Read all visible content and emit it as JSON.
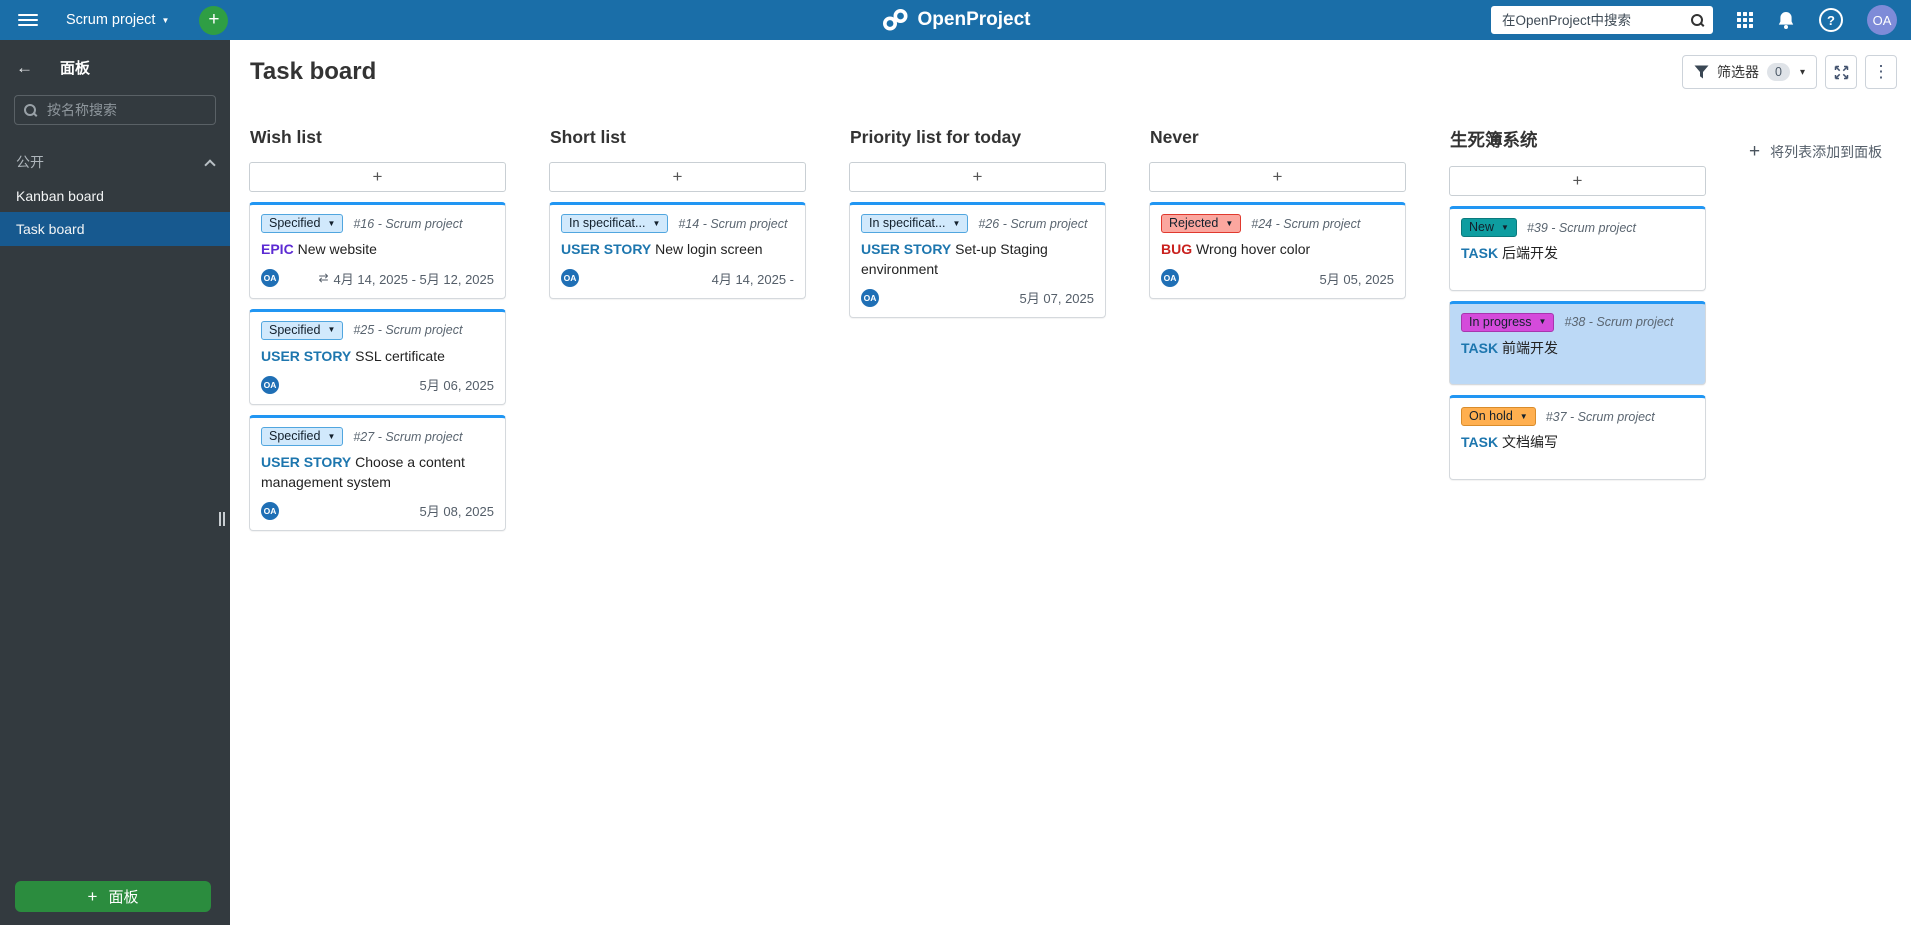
{
  "colors": {
    "header_bg": "#1A6EA8",
    "header_green": "#2F9E44",
    "header_avatar_bg": "#7E8BD8",
    "sidebar_bg": "#333A3F",
    "sidebar_active_bg": "#17598F",
    "sidebar_green": "#2B8C3E",
    "card_accent": "#2196F3",
    "selected_card_bg": "#BCD9F6",
    "avatar_bg": "#1F6FB5",
    "badge": {
      "lightblue": {
        "bg": "#D1E9FC",
        "border": "#51A6DF"
      },
      "red": {
        "bg": "#FBA79F",
        "border": "#E0392E"
      },
      "teal": {
        "bg": "#0E9DA0",
        "border": "#0B7A7D"
      },
      "magenta": {
        "bg": "#D44BDB",
        "border": "#A836AE"
      },
      "orange": {
        "bg": "#FFAF4F",
        "border": "#D98C2B"
      }
    },
    "type": {
      "epic": "#5C2BD3",
      "story": "#1D76AE",
      "bug": "#C9211E",
      "task": "#1D76AE"
    }
  },
  "icons": {
    "back": "←",
    "chevron_down": "▼",
    "dropdown_caret": "▾",
    "kebab": "⋮",
    "help": "?",
    "plus": "+",
    "date_range": "⇄"
  },
  "header": {
    "project_selector": "Scrum project",
    "logo": "OpenProject",
    "search_placeholder": "在OpenProject中搜索",
    "avatar": "OA"
  },
  "sidebar": {
    "title": "面板",
    "search_placeholder": "按名称搜索",
    "section": "公开",
    "items": [
      {
        "label": "Kanban board",
        "active": false
      },
      {
        "label": "Task board",
        "active": true
      }
    ],
    "new_board_label": "面板"
  },
  "toolbar": {
    "page_title": "Task board",
    "filter_label": "筛选器",
    "filter_count": "0"
  },
  "board": {
    "add_list_label": "将列表添加到面板",
    "columns": [
      {
        "title": "Wish list",
        "cards": [
          {
            "status": "Specified",
            "status_color": "lightblue",
            "id": "#16",
            "project": "Scrum project",
            "type": "EPIC",
            "type_key": "epic",
            "title": "New website",
            "avatar": "OA",
            "date": "4月 14, 2025 - 5月 12, 2025",
            "date_icon": true
          },
          {
            "status": "Specified",
            "status_color": "lightblue",
            "id": "#25",
            "project": "Scrum project",
            "type": "USER STORY",
            "type_key": "story",
            "title": "SSL certificate",
            "avatar": "OA",
            "date": "5月 06, 2025"
          },
          {
            "status": "Specified",
            "status_color": "lightblue",
            "id": "#27",
            "project": "Scrum project",
            "type": "USER STORY",
            "type_key": "story",
            "title": "Choose a content management system",
            "avatar": "OA",
            "date": "5月 08, 2025"
          }
        ]
      },
      {
        "title": "Short list",
        "cards": [
          {
            "status": "In specificat...",
            "status_color": "lightblue",
            "id": "#14",
            "project": "Scrum project",
            "type": "USER STORY",
            "type_key": "story",
            "title": "New login screen",
            "avatar": "OA",
            "date": "4月 14, 2025 -"
          }
        ]
      },
      {
        "title": "Priority list for today",
        "cards": [
          {
            "status": "In specificat...",
            "status_color": "lightblue",
            "id": "#26",
            "project": "Scrum project",
            "type": "USER STORY",
            "type_key": "story",
            "title": "Set-up Staging environment",
            "avatar": "OA",
            "date": "5月 07, 2025"
          }
        ]
      },
      {
        "title": "Never",
        "cards": [
          {
            "status": "Rejected",
            "status_color": "red",
            "id": "#24",
            "project": "Scrum project",
            "type": "BUG",
            "type_key": "bug",
            "title": "Wrong hover color",
            "avatar": "OA",
            "date": "5月 05, 2025"
          }
        ]
      },
      {
        "title": "生死簿系统",
        "cards": [
          {
            "status": "New",
            "status_color": "teal",
            "id": "#39",
            "project": "Scrum project",
            "type": "TASK",
            "type_key": "task",
            "title": "后端开发"
          },
          {
            "status": "In progress",
            "status_color": "magenta",
            "id": "#38",
            "project": "Scrum project",
            "type": "TASK",
            "type_key": "task",
            "title": "前端开发",
            "selected": true
          },
          {
            "status": "On hold",
            "status_color": "orange",
            "id": "#37",
            "project": "Scrum project",
            "type": "TASK",
            "type_key": "task",
            "title": "文档编写"
          }
        ]
      }
    ]
  }
}
